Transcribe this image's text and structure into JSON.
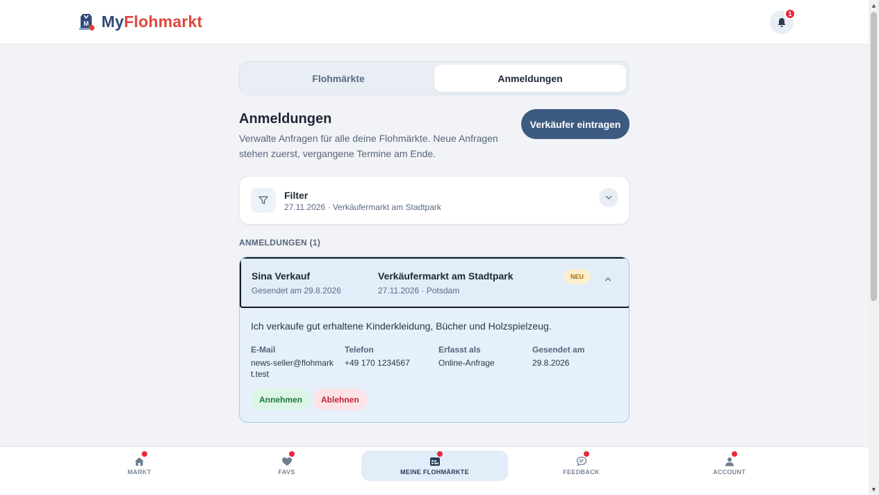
{
  "app": {
    "name_part1": "My",
    "name_part2": "Flohmarkt",
    "notification_count": "1"
  },
  "tabs": [
    {
      "label": "Flohmärkte",
      "active": false
    },
    {
      "label": "Anmeldungen",
      "active": true
    }
  ],
  "page": {
    "title": "Anmeldungen",
    "description": "Verwalte Anfragen für alle deine Flohmärkte. Neue Anfragen stehen zuerst, vergangene Termine am Ende.",
    "primary_action": "Verkäufer eintragen"
  },
  "filter": {
    "label": "Filter",
    "summary": "27.11.2026 · Verkäufermarkt am Stadtpark"
  },
  "list": {
    "section_label": "ANMELDUNGEN (1)",
    "entries": [
      {
        "name": "Sina Verkauf",
        "sent": "Gesendet am 29.8.2026",
        "market": "Verkäufermarkt am Stadtpark",
        "market_meta": "27.11.2026 · Potsdam",
        "badge": "NEU",
        "expanded": true,
        "message": "Ich verkaufe gut erhaltene Kinderkleidung, Bücher und Holzspielzeug.",
        "details": [
          {
            "label": "E-Mail",
            "value": "news-seller@flohmarkt.test"
          },
          {
            "label": "Telefon",
            "value": "+49 170 1234567"
          },
          {
            "label": "Erfasst als",
            "value": "Online-Anfrage"
          },
          {
            "label": "Gesendet am",
            "value": "29.8.2026"
          }
        ],
        "accept_label": "Annehmen",
        "reject_label": "Ablehnen"
      }
    ]
  },
  "bottom_nav": [
    {
      "label": "MARKT",
      "icon": "home-icon",
      "active": false,
      "dot": true
    },
    {
      "label": "FAVS",
      "icon": "heart-icon",
      "active": false,
      "dot": true
    },
    {
      "label": "MEINE FLOHMÄRKTE",
      "icon": "calendar-icon",
      "active": true,
      "dot": true
    },
    {
      "label": "FEEDBACK",
      "icon": "chat-icon",
      "active": false,
      "dot": true
    },
    {
      "label": "ACCOUNT",
      "icon": "user-icon",
      "active": false,
      "dot": true
    }
  ],
  "colors": {
    "brand_dark": "#2f4a78",
    "brand_red": "#e0453d",
    "primary_button": "#3d5a80",
    "badge_dot": "#e8283b"
  }
}
